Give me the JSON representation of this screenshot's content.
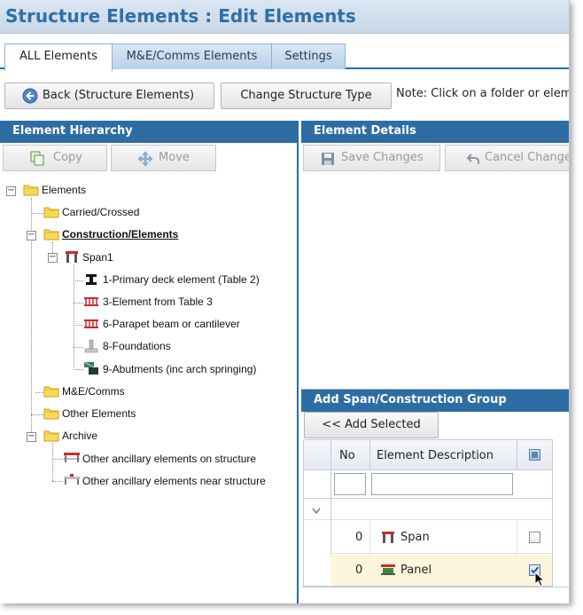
{
  "title": "Structure Elements : Edit Elements",
  "tabs": [
    "ALL Elements",
    "M&E/Comms Elements",
    "Settings"
  ],
  "toolbar": {
    "back_label": "Back (Structure Elements)",
    "change_type_label": "Change Structure Type",
    "note": "Note: Click on a folder or elem"
  },
  "hierarchy": {
    "header": "Element Hierarchy",
    "copy_label": "Copy",
    "move_label": "Move",
    "nodes": {
      "elements": "Elements",
      "carried": "Carried/Crossed",
      "construction": "Construction/Elements",
      "span1": "Span1",
      "primary_deck": "1-Primary deck element (Table 2)",
      "element_table3": "3-Element from Table 3",
      "parapet": "6-Parapet beam or cantilever",
      "foundations": "8-Foundations",
      "abutments": "9-Abutments (inc arch springing)",
      "me_comms": "M&E/Comms",
      "other_elements": "Other Elements",
      "archive": "Archive",
      "ancillary_on": "Other ancillary elements on structure",
      "ancillary_near": "Other ancillary elements near structure"
    }
  },
  "details": {
    "header": "Element Details",
    "save_label": "Save Changes",
    "cancel_label": "Cancel Change"
  },
  "add_group": {
    "header": "Add Span/Construction Group",
    "add_selected_label": "<< Add Selected",
    "columns": {
      "no": "No",
      "description": "Element Description"
    },
    "rows": [
      {
        "no": "0",
        "description": "Span",
        "checked": false
      },
      {
        "no": "0",
        "description": "Panel",
        "checked": true
      }
    ]
  },
  "colors": {
    "accent": "#2e6da4",
    "title_text": "#2f6fa8",
    "highlight_row": "#fdf6dc"
  }
}
